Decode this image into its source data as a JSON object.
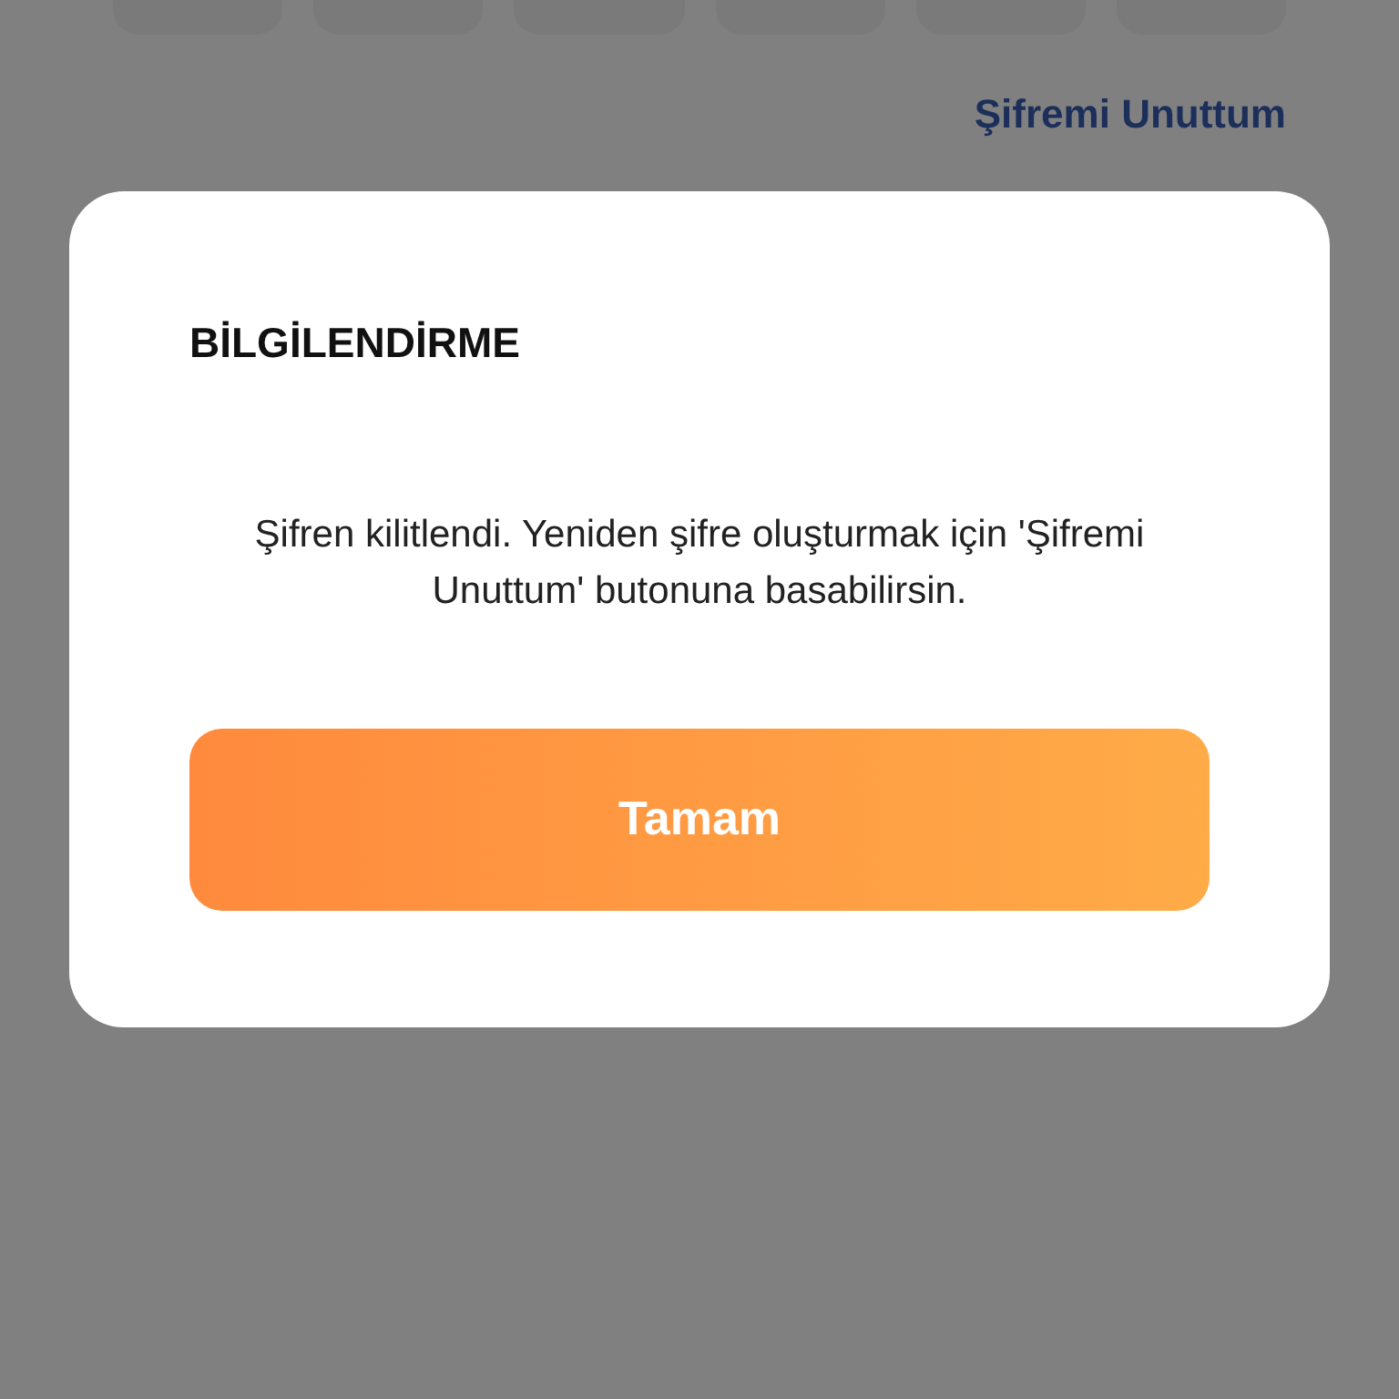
{
  "background": {
    "pin_boxes": [
      {
        "filled": false
      },
      {
        "filled": false
      },
      {
        "filled": false
      },
      {
        "filled": false
      },
      {
        "filled": false
      },
      {
        "filled": false
      }
    ],
    "forgot_link": "Şifremi Unuttum"
  },
  "dialog": {
    "title": "BİLGİLENDİRME",
    "message": "Şifren kilitlendi. Yeniden şifre oluşturmak için 'Şifremi Unuttum' butonuna basabilirsin.",
    "button": "Tamam"
  }
}
